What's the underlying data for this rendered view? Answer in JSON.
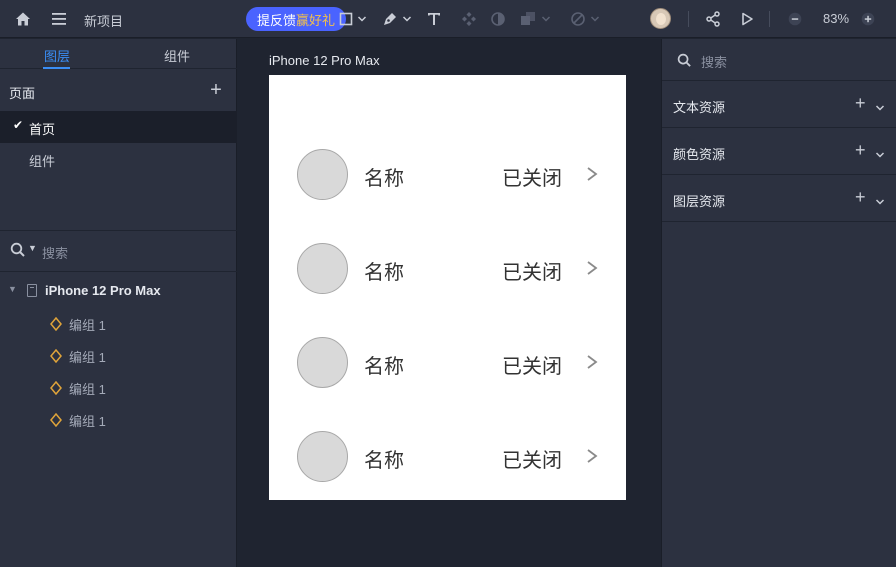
{
  "toolbar": {
    "project_title": "新项目",
    "feedback_label": "提反馈",
    "feedback_gift": "赢好礼",
    "zoom": "83%"
  },
  "left_panel": {
    "tabs": [
      {
        "label": "图层",
        "active": true
      },
      {
        "label": "组件",
        "active": false
      }
    ],
    "pages_title": "页面",
    "pages": [
      {
        "label": "首页",
        "selected": true
      },
      {
        "label": "组件",
        "selected": false
      }
    ],
    "search_placeholder": "搜索",
    "tree": {
      "root_label": "iPhone 12 Pro Max",
      "children": [
        "编组 1",
        "编组 1",
        "编组 1",
        "编组 1"
      ]
    }
  },
  "canvas": {
    "artboard_title": "iPhone 12 Pro Max",
    "rows": [
      {
        "name": "名称",
        "status": "已关闭"
      },
      {
        "name": "名称",
        "status": "已关闭"
      },
      {
        "name": "名称",
        "status": "已关闭"
      },
      {
        "name": "名称",
        "status": "已关闭"
      }
    ]
  },
  "right_panel": {
    "search_placeholder": "搜索",
    "resources": [
      {
        "label": "文本资源"
      },
      {
        "label": "颜色资源"
      },
      {
        "label": "图层资源"
      }
    ]
  },
  "colors": {
    "accent": "#3a8ef6",
    "feedback_button": "#4a63ff",
    "panel_bg": "#2c3140",
    "canvas_bg": "#1f2430",
    "group_icon": "#e0a43a"
  }
}
